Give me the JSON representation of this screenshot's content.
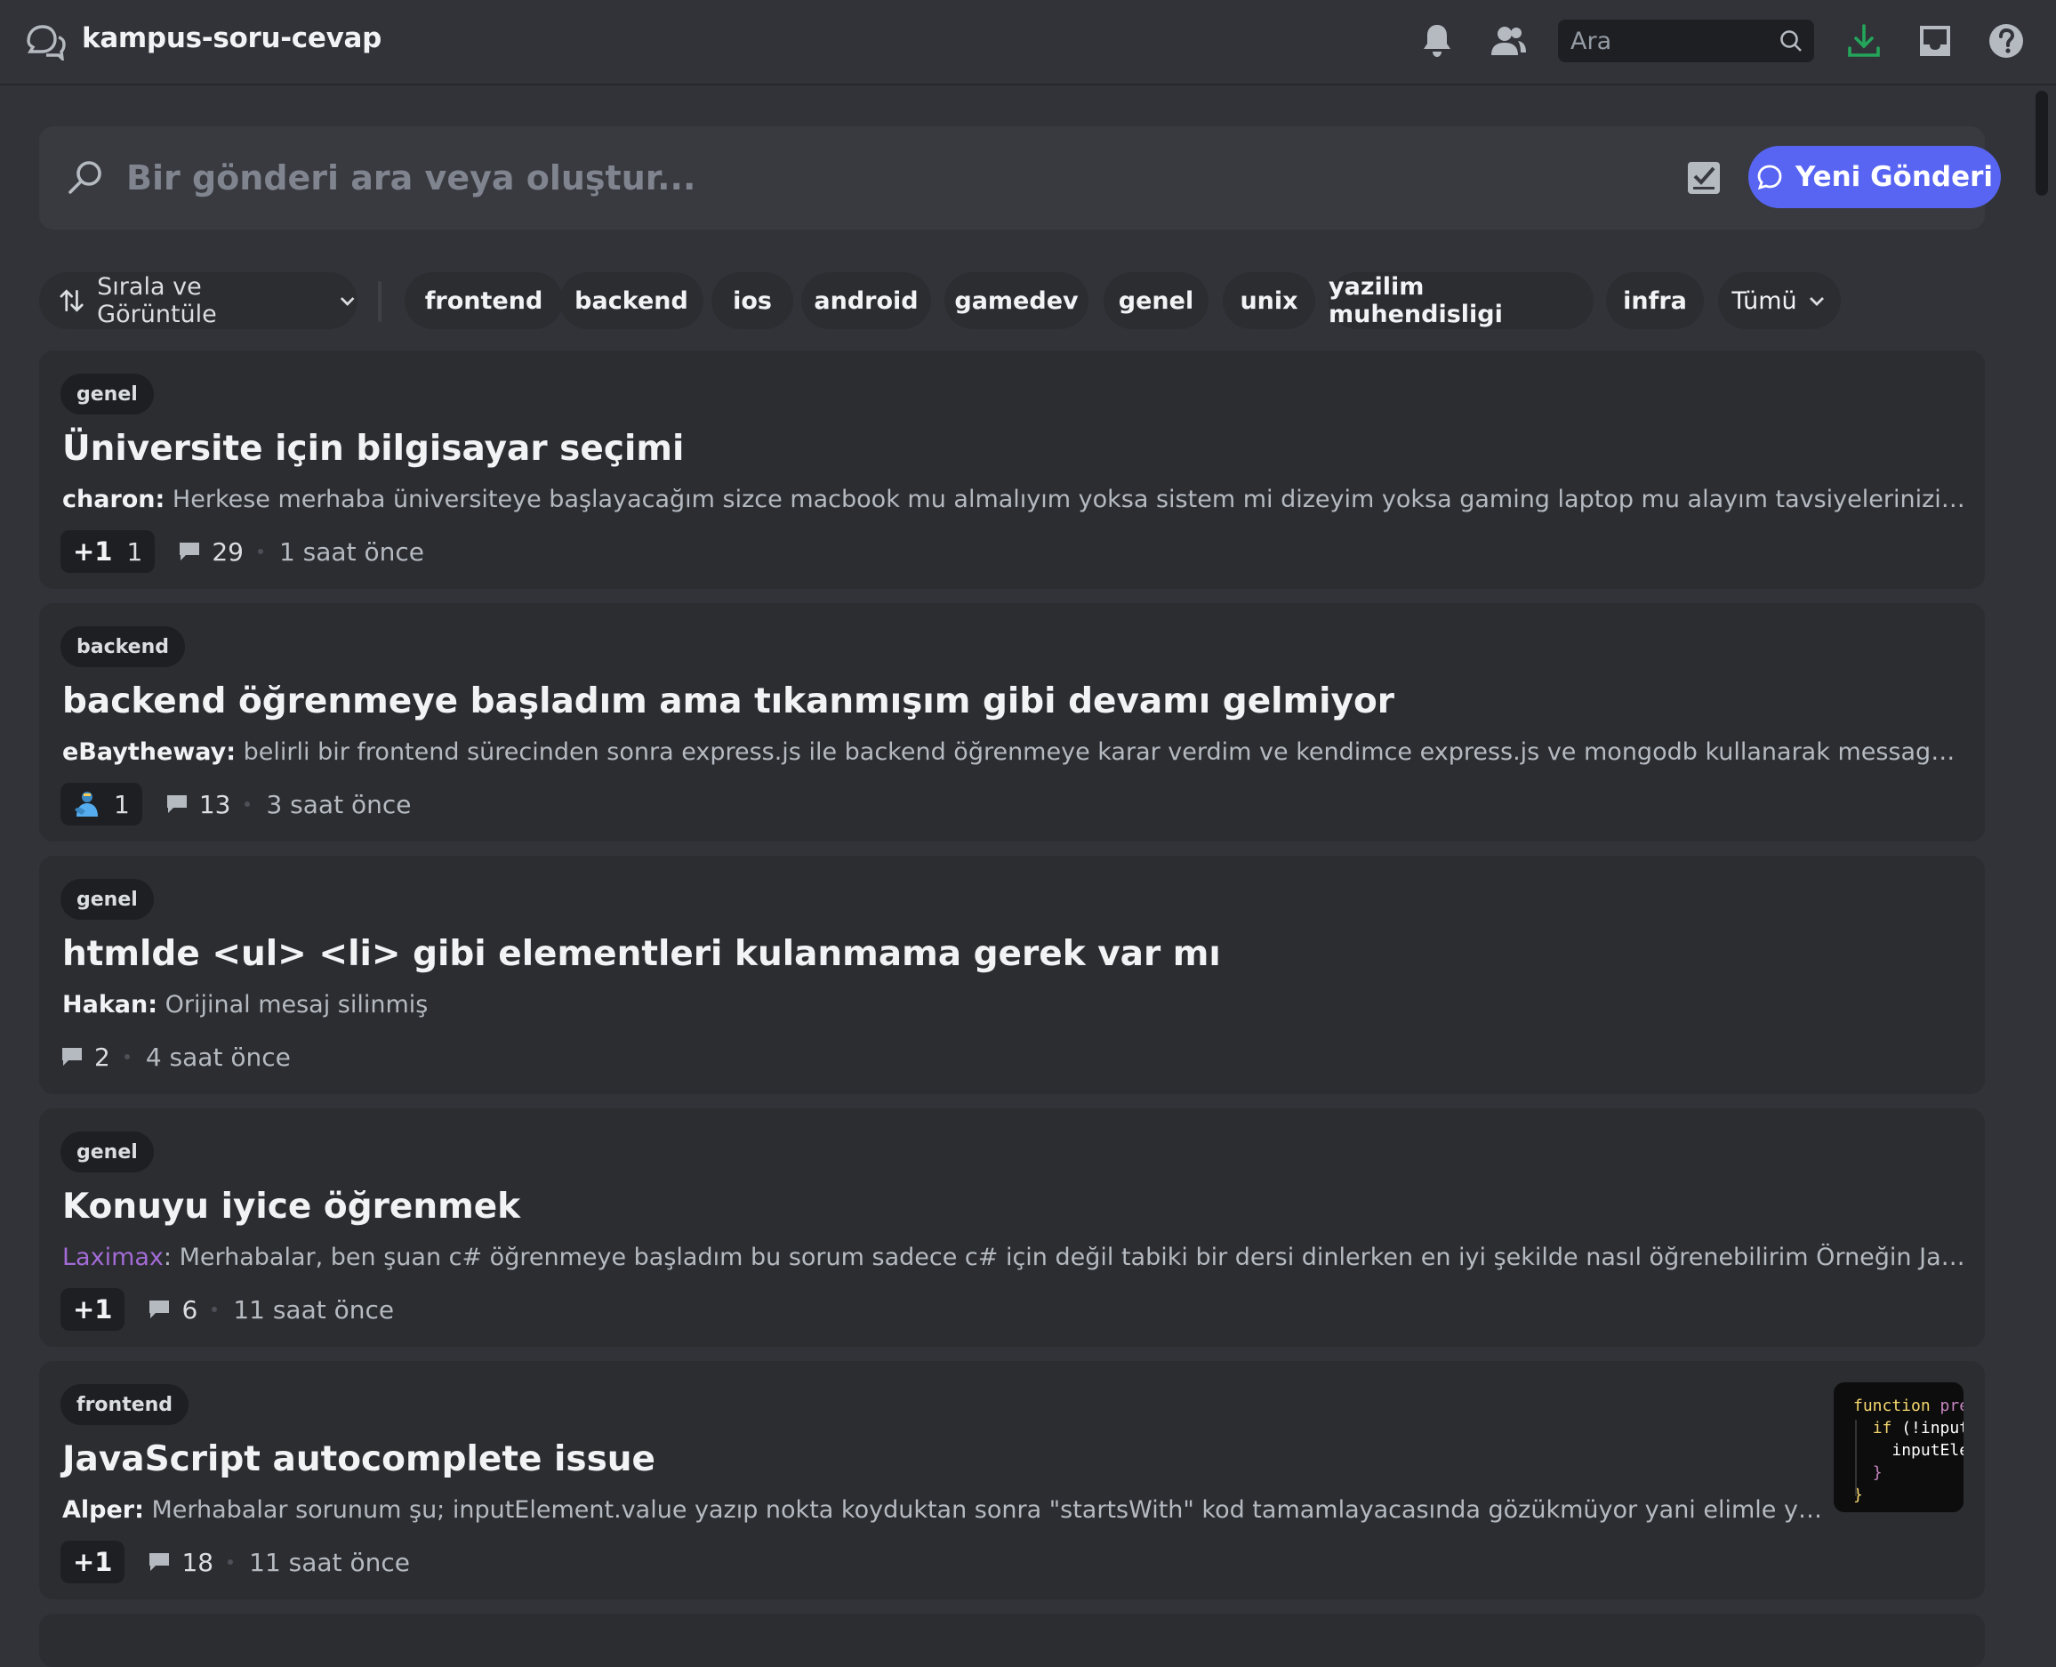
{
  "topbar": {
    "channel_name": "kampus-soru-cevap",
    "channel_icon": "forum-bubbles-icon",
    "search_placeholder": "Ara",
    "icons": [
      "bell-icon",
      "members-icon",
      "search-icon",
      "download-icon",
      "inbox-icon",
      "help-icon"
    ],
    "download_color": "#23a55a"
  },
  "post_search": {
    "placeholder": "Bir gönderi ara veya oluştur...",
    "new_post_label": "Yeni Gönderi",
    "accent": "#5865f2"
  },
  "filters": {
    "sort_label": "Sırala ve Görüntüle",
    "tags": [
      "frontend",
      "backend",
      "ios",
      "android",
      "gamedev",
      "genel",
      "unix",
      "yazilim muhendisligi",
      "infra"
    ],
    "more_label": "Tümü"
  },
  "posts": [
    {
      "tag": "genel",
      "title": "Üniversite için bilgisayar seçimi",
      "author": "charon:",
      "snippet": " Herkese merhaba üniversiteye başlayacağım sizce macbook mu almalıyım yoksa sistem mi dizeyim yoksa gaming laptop mu alayım tavsiyelerinizi bekliyorum",
      "reaction": "+1",
      "reaction_count": "1",
      "messages": "29",
      "time": "1 saat önce"
    },
    {
      "tag": "backend",
      "title": "backend öğrenmeye başladım ama tıkanmışım gibi devamı gelmiyor",
      "author": "eBaytheway:",
      "snippet": " belirli bir frontend sürecinden sonra express.js ile backend öğrenmeye karar verdim ve kendimce express.js ve mongodb kullanarak message board için backend yaz...",
      "reaction_icon": "person-hugging-emoji-icon",
      "reaction_count": "1",
      "messages": "13",
      "time": "3 saat önce"
    },
    {
      "tag": "genel",
      "title": "htmlde <ul> <li> gibi elementleri kulanmama gerek var mı",
      "author": "Hakan:",
      "snippet": " Orijinal mesaj silinmiş",
      "messages": "2",
      "time": "4 saat önce"
    },
    {
      "tag": "genel",
      "title": "Konuyu iyice öğrenmek",
      "author": "Laximax",
      "author_color": "#a36bd6",
      "snippet": ": Merhabalar, ben şuan c# öğrenmeye başladım bu sorum sadece c# için değil tabiki bir dersi dinlerken en iyi şekilde nasıl öğrenebilirim Örneğin JavaScript de Data Type...",
      "reaction": "+1",
      "messages": "6",
      "time": "11 saat önce"
    },
    {
      "tag": "frontend",
      "title": "JavaScript autocomplete issue",
      "author": "Alper:",
      "snippet": " Merhabalar sorunum şu; inputElement.value yazıp nokta koyduktan sonra \"startsWith\" kod tamamlayacasında gözükmüyor yani elimle yazıyorum ama soru...",
      "reaction": "+1",
      "messages": "18",
      "time": "11 saat önce",
      "thumbnail_code": {
        "line1_kw": "function",
        "line1_rest": " pre",
        "line2_kw": "if",
        "line2_rest": " (!input",
        "line3": "inputEle",
        "line4": "}",
        "line5": "}"
      }
    }
  ]
}
